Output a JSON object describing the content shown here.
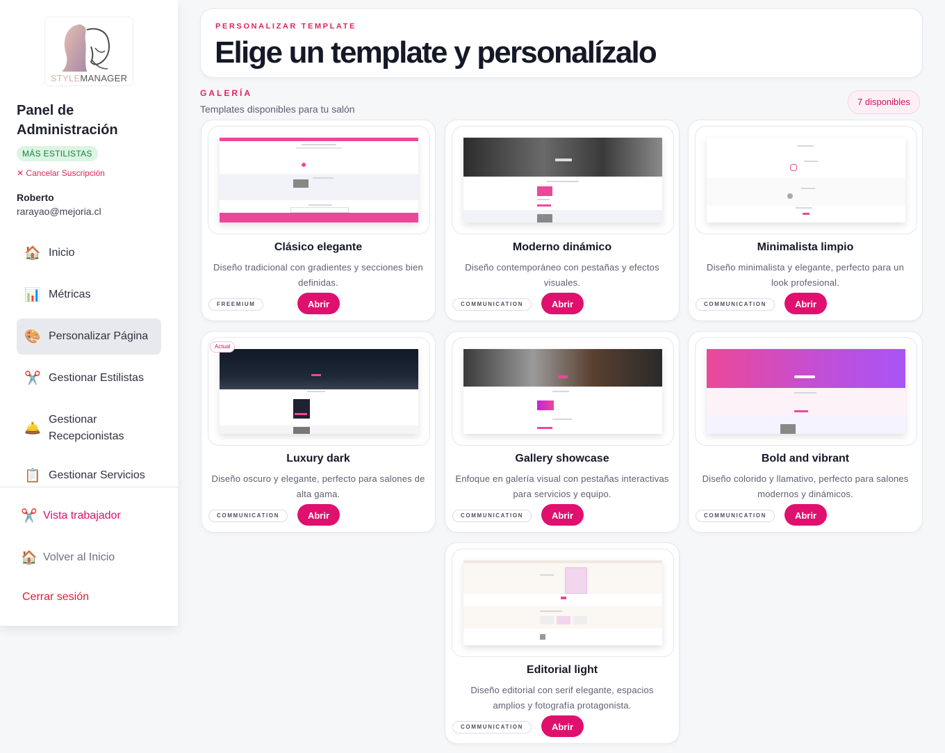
{
  "sidebar": {
    "logo": {
      "part1": "STYLE",
      "part2": "MANAGER"
    },
    "title": "Panel de Administración",
    "plan_badge": "MÁS ESTILISTAS",
    "cancel_link": "Cancelar Suscripción",
    "user": {
      "name": "Roberto",
      "email": "rarayao@mejoria.cl"
    },
    "nav": [
      {
        "icon": "house-icon",
        "glyph": "🏠",
        "label": "Inicio",
        "active": false
      },
      {
        "icon": "bar-chart-icon",
        "glyph": "📊",
        "label": "Métricas",
        "active": false
      },
      {
        "icon": "palette-icon",
        "glyph": "🎨",
        "label": "Personalizar Página",
        "active": true
      },
      {
        "icon": "scissors-icon",
        "glyph": "✂️",
        "label": "Gestionar Estilistas",
        "active": false
      },
      {
        "icon": "bell-icon",
        "glyph": "🛎️",
        "label": "Gestionar Recepcionistas",
        "active": false
      },
      {
        "icon": "clipboard-icon",
        "glyph": "📋",
        "label": "Gestionar Servicios",
        "active": false
      }
    ],
    "bottom": {
      "worker_view": {
        "glyph": "✂️",
        "label": "Vista trabajador"
      },
      "back_home": {
        "glyph": "🏠",
        "label": "Volver al Inicio"
      },
      "logout": {
        "label": "Cerrar sesión"
      }
    }
  },
  "header": {
    "eyebrow": "PERSONALIZAR TEMPLATE",
    "title": "Elige un template y personalízalo"
  },
  "gallery": {
    "eyebrow": "GALERÍA",
    "subtitle": "Templates disponibles para tu salón",
    "count_badge": "7 disponibles",
    "open_label": "Abrir",
    "current_label": "Actual",
    "templates": [
      {
        "name": "Clásico elegante",
        "description": "Diseño tradicional con gradientes y secciones bien definidas.",
        "tag": "FREEMIUM",
        "current": false
      },
      {
        "name": "Moderno dinámico",
        "description": "Diseño contemporáneo con pestañas y efectos visuales.",
        "tag": "COMMUNICATION",
        "current": false
      },
      {
        "name": "Minimalista limpio",
        "description": "Diseño minimalista y elegante, perfecto para un look profesional.",
        "tag": "COMMUNICATION",
        "current": false
      },
      {
        "name": "Luxury dark",
        "description": "Diseño oscuro y elegante, perfecto para salones de alta gama.",
        "tag": "COMMUNICATION",
        "current": true
      },
      {
        "name": "Gallery showcase",
        "description": "Enfoque en galería visual con pestañas interactivas para servicios y equipo.",
        "tag": "COMMUNICATION",
        "current": false
      },
      {
        "name": "Bold and vibrant",
        "description": "Diseño colorido y llamativo, perfecto para salones modernos y dinámicos.",
        "tag": "COMMUNICATION",
        "current": false
      },
      {
        "name": "Editorial light",
        "description": "Diseño editorial con serif elegante, espacios amplios y fotografía protagonista.",
        "tag": "COMMUNICATION",
        "current": false
      }
    ]
  },
  "colors": {
    "accent": "#e0106e",
    "success": "#15803d",
    "danger": "#e01c34"
  }
}
